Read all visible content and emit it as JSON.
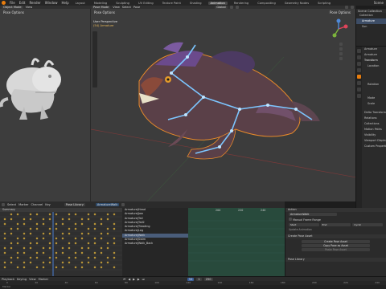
{
  "topbar": {
    "menus": [
      "File",
      "Edit",
      "Render",
      "Window",
      "Help"
    ],
    "workspaces": [
      "Layout",
      "Modeling",
      "Sculpting",
      "UV Editing",
      "Texture Paint",
      "Shading",
      "Animation",
      "Rendering",
      "Compositing",
      "Geometry Nodes",
      "Scripting"
    ],
    "active_workspace": "Animation",
    "scene": "Scene"
  },
  "left_view": {
    "mode": "Object Mode",
    "menus": [
      "View"
    ],
    "overlay": "Pose Options"
  },
  "main_view": {
    "mode": "Pose Mode",
    "menus": [
      "View",
      "Select",
      "Pose"
    ],
    "transform": "Global",
    "overlay": "Pose Options",
    "info_line1": "User Perspective",
    "info_line2": "(54) Armature"
  },
  "outliner": {
    "title": "Scene Collection",
    "items": [
      "Collection",
      "Armature",
      "Sun"
    ]
  },
  "properties": {
    "object_name": "Armature",
    "pose_name": "Armature",
    "sections": [
      "Transform",
      "Delta Transform",
      "Relations",
      "Collections",
      "Motion Paths",
      "Visibility",
      "Viewport Display",
      "Custom Properties"
    ],
    "fields": [
      "Location",
      "Rotation",
      "Mode",
      "Scale"
    ]
  },
  "dope": {
    "menus": [
      "Select",
      "Marker",
      "Channel",
      "Key"
    ],
    "mode": "Pose Library",
    "action": "ArmatureWalk",
    "summary": "Summary",
    "frames": [
      "20",
      "40",
      "60",
      "80",
      "100",
      "120",
      "140",
      "160",
      "180",
      "200",
      "220",
      "240"
    ]
  },
  "bones": [
    "Armature|Head",
    "Armature|Jaw",
    "Armature|Tail",
    "Armature|Tail2",
    "Armature|Treading",
    "Armature|Leg",
    "Armature|Walk",
    "Armature|Swim",
    "Armature|Walk_Back"
  ],
  "selected_bone": "Armature|Walk",
  "pose_panel": {
    "action_label": "Action",
    "action_value": "ArmatureWalk",
    "manual_range": "Manual Frame Range",
    "range_labels": [
      "Start",
      "End",
      "Cyclic"
    ],
    "update_btn": "Update Animation",
    "create_header": "Create Pose Asset",
    "create_btn": "Create Pose Asset",
    "copy_btn": "Copy Pose as Asset",
    "paste_btn": "Paste Pose Asset",
    "pose_library_header": "Pose Library"
  },
  "timeline": {
    "menus": [
      "Playback",
      "Keying",
      "View",
      "Marker"
    ],
    "current_frame": "54",
    "start": "1",
    "end": "250",
    "ticks": [
      "0",
      "20",
      "40",
      "60",
      "80",
      "100",
      "120",
      "140",
      "160",
      "180",
      "200",
      "220",
      "240"
    ]
  },
  "status": {
    "text": "Marker"
  },
  "colors": {
    "accent": "#e87d0d",
    "selection_outline": "#e88a2a",
    "bone_blue": "#7cc6ff",
    "keyframe": "#c9a13a"
  }
}
